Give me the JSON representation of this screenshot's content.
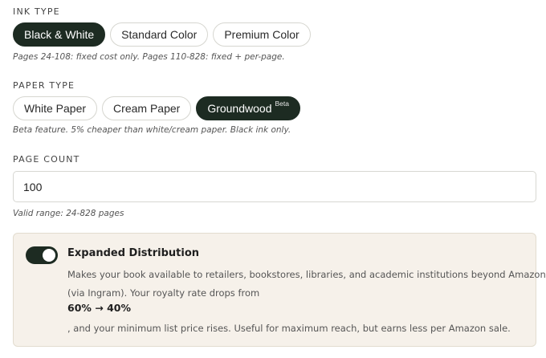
{
  "ink_type": {
    "label": "INK TYPE",
    "options": [
      "Black & White",
      "Standard Color",
      "Premium Color"
    ],
    "selected": "Black & White",
    "hint": "Pages 24-108: fixed cost only. Pages 110-828: fixed + per-page."
  },
  "paper_type": {
    "label": "PAPER TYPE",
    "options": [
      "White Paper",
      "Cream Paper",
      "Groundwood"
    ],
    "beta_badge": "Beta",
    "selected": "Groundwood",
    "hint": "Beta feature. 5% cheaper than white/cream paper. Black ink only."
  },
  "page_count": {
    "label": "PAGE COUNT",
    "value": "100",
    "hint": "Valid range: 24-828 pages"
  },
  "expanded_distribution": {
    "enabled": true,
    "title": "Expanded Distribution",
    "description_line1": "Makes your book available to retailers, bookstores, libraries, and academic institutions beyond Amazon",
    "description_line2": "(via Ingram). Your royalty rate drops from",
    "rate_change": "60% → 40%",
    "description_line3": ", and your minimum list price rises. Useful for maximum reach, but earns less per Amazon sale."
  },
  "colors": {
    "selected_bg": "#1d2b22",
    "card_bg": "#f6f1ea",
    "border": "#d6d6d0"
  }
}
